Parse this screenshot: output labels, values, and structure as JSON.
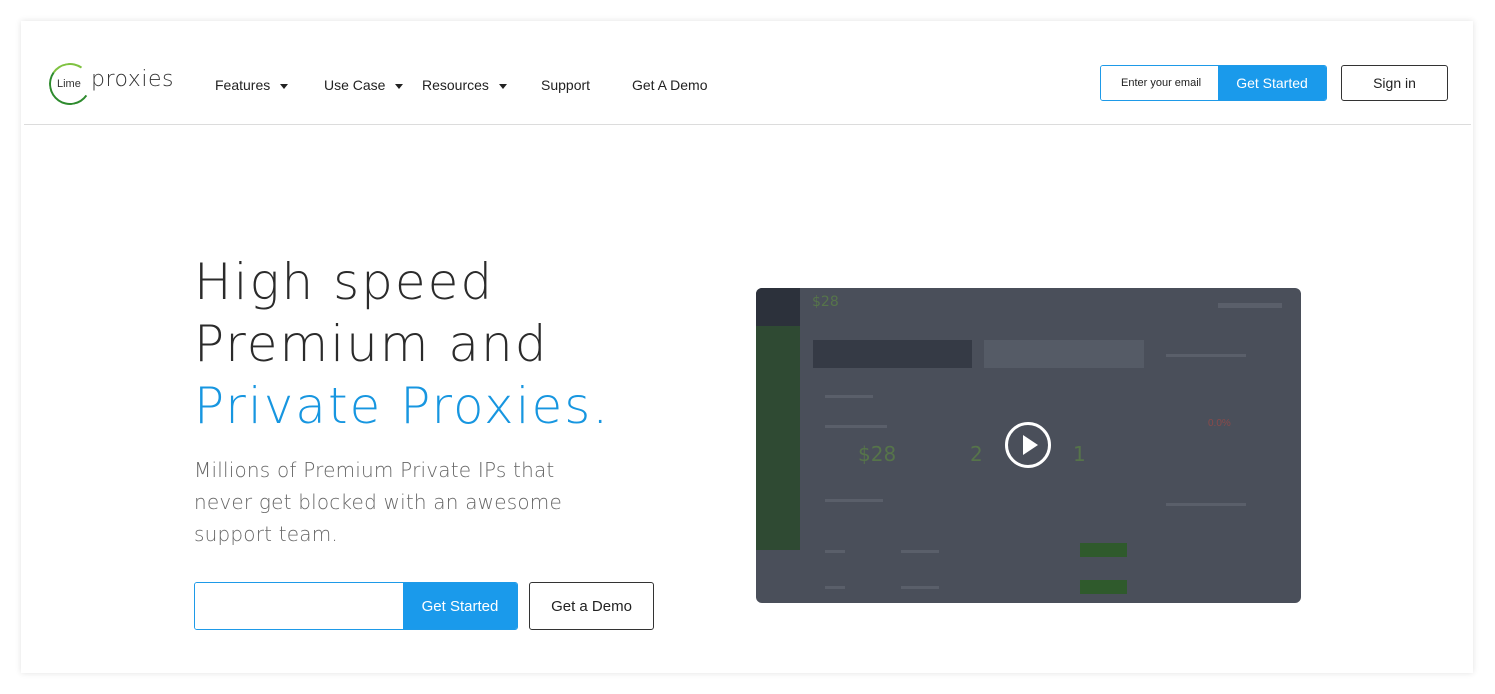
{
  "brand": {
    "small": "Lime",
    "name": "proxies"
  },
  "nav": {
    "features": "Features",
    "use_case": "Use Case",
    "resources": "Resources",
    "support": "Support",
    "demo": "Get A Demo"
  },
  "header_form": {
    "email_placeholder": "Enter your email",
    "submit": "Get Started"
  },
  "signin": "Sign in",
  "hero": {
    "line1": "High speed",
    "line2": "Premium and",
    "line3_accent": "Private Proxies.",
    "subtitle": "Millions of Premium Private IPs that never get blocked with an awesome support team.",
    "cta": "Get Started",
    "demo": "Get a Demo"
  },
  "video_preview": {
    "balance": "$28",
    "stats": [
      "$28",
      "2",
      "1"
    ],
    "percent": "0.0%"
  },
  "colors": {
    "accent": "#1a9aeb",
    "text": "#2b2b2b",
    "video_overlay": "#4a4f5a"
  }
}
